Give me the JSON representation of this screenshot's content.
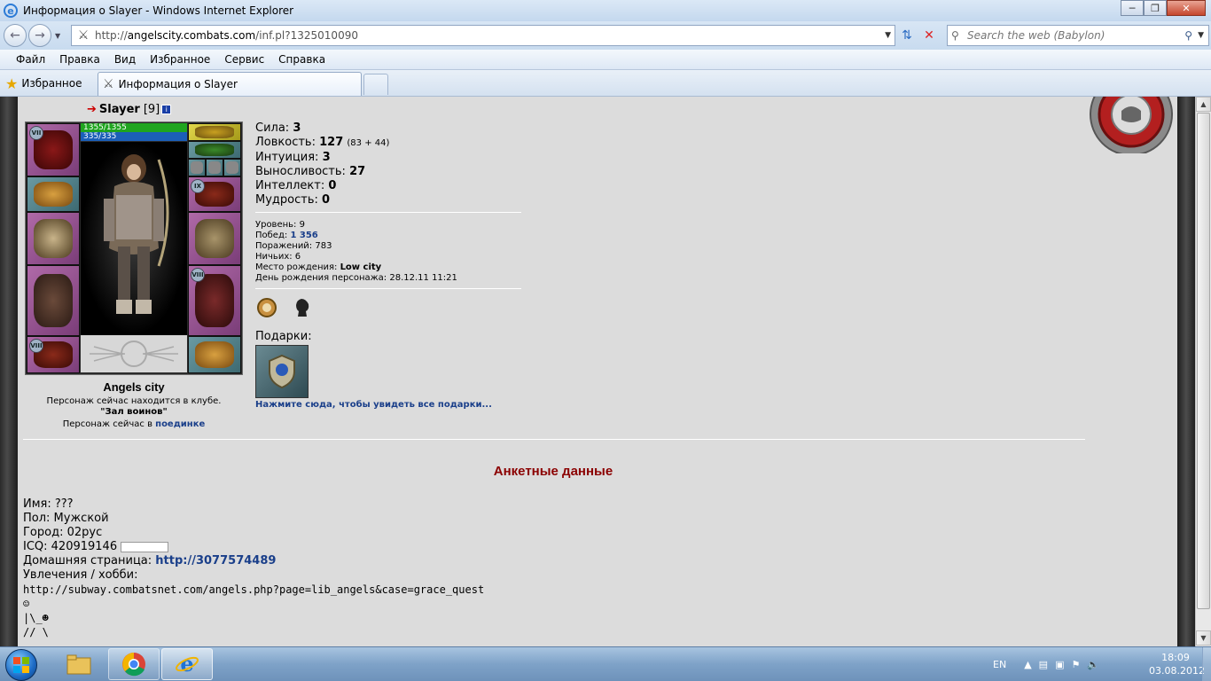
{
  "window": {
    "title": "Информация о Slayer - Windows Internet Explorer",
    "min": "─",
    "max": "❐",
    "close": "✕"
  },
  "address": {
    "url_prefix": "http://",
    "url_domain": "angelscity.combats.com",
    "url_path": "/inf.pl?1325010090",
    "search_placeholder": "Search the web (Babylon)"
  },
  "menu": [
    "Файл",
    "Правка",
    "Вид",
    "Избранное",
    "Сервис",
    "Справка"
  ],
  "favorites": {
    "label": "Избранное"
  },
  "tab": {
    "title": "Информация о Slayer"
  },
  "character": {
    "nick": "Slayer",
    "level_badge": "[9]",
    "info_badge": "i",
    "hp": "1355/1355",
    "mana": "335/335",
    "tiers": [
      "VII",
      "IX",
      "VIII",
      "VIII"
    ],
    "city": "Angels city",
    "club_line": "Персонаж сейчас находится в клубе.",
    "club_room": "\"Зал воинов\"",
    "fight_line_prefix": "Персонаж сейчас в",
    "fight_link": "поединке"
  },
  "stats": [
    {
      "label": "Сила:",
      "value": "3",
      "extra": ""
    },
    {
      "label": "Ловкость:",
      "value": "127",
      "extra": "(83 + 44)"
    },
    {
      "label": "Интуиция:",
      "value": "3",
      "extra": ""
    },
    {
      "label": "Выносливость:",
      "value": "27",
      "extra": ""
    },
    {
      "label": "Интеллект:",
      "value": "0",
      "extra": ""
    },
    {
      "label": "Мудрость:",
      "value": "0",
      "extra": ""
    }
  ],
  "info": {
    "level": "Уровень: 9",
    "wins_label": "Побед:",
    "wins_value": "1 356",
    "losses": "Поражений: 783",
    "draws": "Ничьих: 6",
    "birthplace_label": "Место рождения:",
    "birthplace_value": "Low city",
    "birthday": "День рождения персонажа: 28.12.11 11:21"
  },
  "gifts": {
    "label": "Подарки:",
    "link": "Нажмите сюда, чтобы увидеть все подарки..."
  },
  "anketa": {
    "title": "Анкетные данные",
    "name": "Имя: ???",
    "gender": "Пол: Мужской",
    "city": "Город: 02рус",
    "icq": "ICQ: 420919146",
    "home_label": "Домашняя страница:",
    "home_link": "http://3077574489",
    "hobby_label": "Увлечения / хобби:",
    "hobby_url": "http://subway.combatsnet.com/angels.php?page=lib_angels&case=grace_quest",
    "hobby_art1": "☺",
    "hobby_art2": "|\\_☻",
    "hobby_art3": "// \\"
  },
  "taskbar": {
    "lang": "EN",
    "time": "18:09",
    "date": "03.08.2012"
  }
}
